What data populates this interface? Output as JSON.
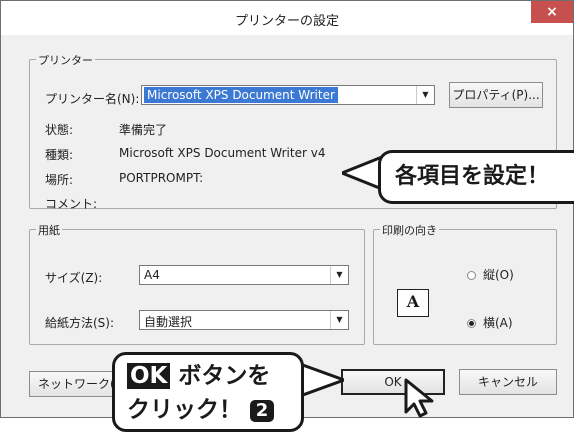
{
  "window": {
    "title": "プリンターの設定",
    "close": "×"
  },
  "printer": {
    "legend": "プリンター",
    "name_label": "プリンター名(N):",
    "name_value": "Microsoft XPS Document Writer",
    "properties_button": "プロパティ(P)...",
    "status_label": "状態:",
    "status_value": "準備完了",
    "type_label": "種類:",
    "type_value": "Microsoft XPS Document Writer v4",
    "location_label": "場所:",
    "location_value": "PORTPROMPT:",
    "comment_label": "コメント:"
  },
  "paper": {
    "legend": "用紙",
    "size_label": "サイズ(Z):",
    "size_value": "A4",
    "source_label": "給紙方法(S):",
    "source_value": "自動選択"
  },
  "orientation": {
    "legend": "印刷の向き",
    "portrait": "縦(O)",
    "landscape": "横(A)",
    "selected": "landscape",
    "icon_letter": "A"
  },
  "buttons": {
    "network": "ネットワーク(W)",
    "ok": "OK",
    "cancel": "キャンセル"
  },
  "callouts": {
    "settings": "各項目を設定！",
    "ok_highlight": "OK",
    "ok_rest": " ボタンを",
    "click": "クリック！",
    "step": "2"
  }
}
